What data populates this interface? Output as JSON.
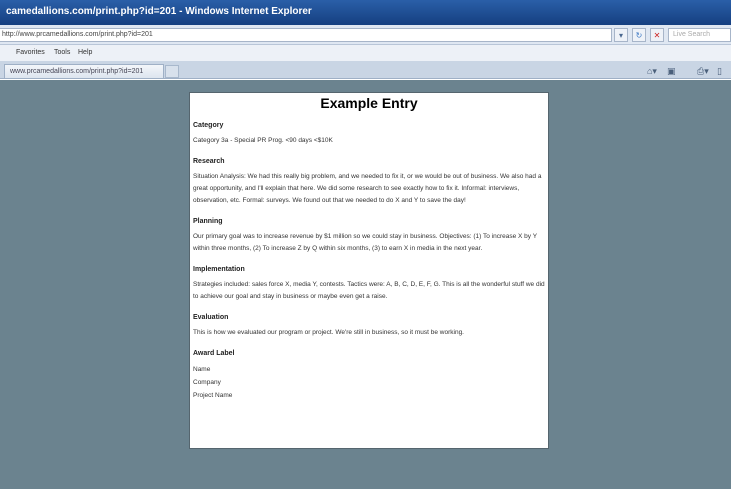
{
  "window": {
    "title": "camedallions.com/print.php?id=201 - Windows Internet Explorer"
  },
  "address_bar": {
    "url": "http://www.prcamedallions.com/print.php?id=201",
    "search_placeholder": "Live Search"
  },
  "menu": {
    "items": [
      "Favorites",
      "Tools",
      "Help"
    ]
  },
  "tab": {
    "label": "www.prcamedallions.com/print.php?id=201"
  },
  "page": {
    "title": "Example Entry",
    "category": {
      "heading": "Category",
      "body": "Category 3a - Special PR Prog. <90 days <$10K"
    },
    "research": {
      "heading": "Research",
      "body": "Situation Analysis: We had this really big problem, and we needed to fix it, or we would be out of business. We also had a great opportunity, and I'll explain that here. We did some research to see exactly how to fix it. Informal: interviews, observation, etc. Formal: surveys. We found out that we needed to do X and Y to save the day!"
    },
    "planning": {
      "heading": "Planning",
      "body": "Our primary goal was to increase revenue by $1 million so we could stay in business. Objectives: (1) To increase X by Y within three months, (2) To increase Z by Q within six months, (3) to earn X in media in the next year."
    },
    "implementation": {
      "heading": "Implementation",
      "body": "Strategies included: sales force X, media Y, contests. Tactics were: A, B, C, D, E, F, G. This is all the wonderful stuff we did to achieve our goal and stay in business or maybe even get a raise."
    },
    "evaluation": {
      "heading": "Evaluation",
      "body": "This is how we evaluated our program or project. We're still in business, so it must be working."
    },
    "award_label": {
      "heading": "Award Label",
      "lines": [
        "Name",
        "Company",
        "Project Name"
      ]
    }
  }
}
